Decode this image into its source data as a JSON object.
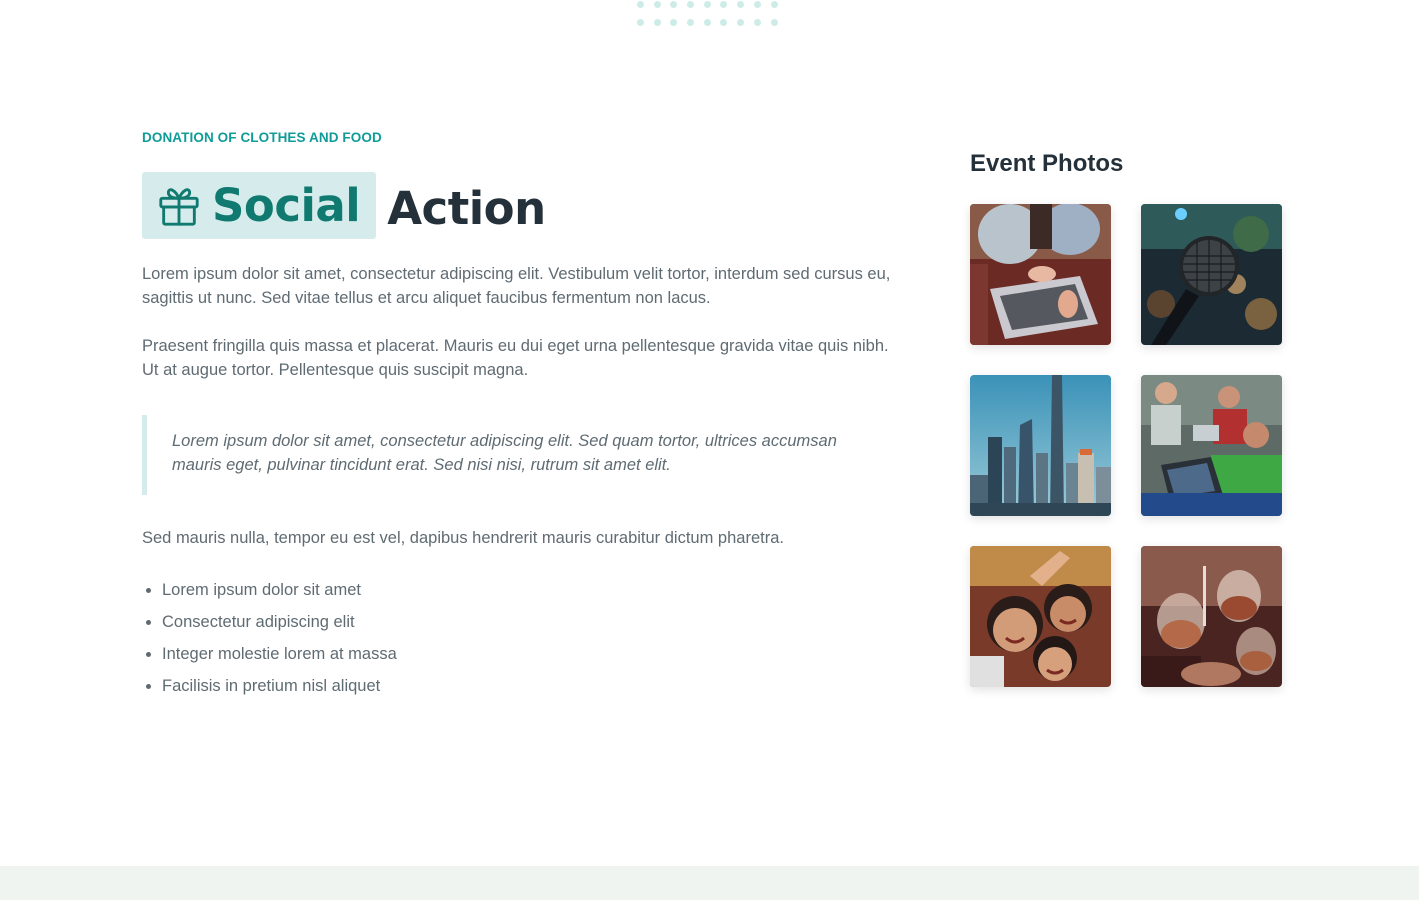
{
  "section": {
    "eyebrow": "DONATION OF CLOTHES AND FOOD",
    "title_accent": "Social",
    "title_rest": "Action",
    "title_icon": "gift-icon",
    "paragraph_1": "Lorem ipsum dolor sit amet, consectetur adipiscing elit. Vestibulum velit tortor, interdum sed cursus eu, sagittis ut nunc. Sed vitae tellus et arcu aliquet faucibus fermentum non lacus.",
    "paragraph_2": "Praesent fringilla quis massa et placerat. Mauris eu dui eget urna pellentesque gravida vitae quis nibh. Ut at augue tortor. Pellentesque quis suscipit magna.",
    "quote": "Lorem ipsum dolor sit amet, consectetur adipiscing elit. Sed quam tortor, ultrices accumsan mauris eget, pulvinar tincidunt erat. Sed nisi nisi, rutrum sit amet elit.",
    "paragraph_3": "Sed mauris nulla, tempor eu est vel, dapibus hendrerit mauris curabitur dictum pharetra.",
    "bullets": [
      "Lorem ipsum dolor sit amet",
      "Consectetur adipiscing elit",
      "Integer molestie lorem at massa",
      "Facilisis in pretium nisl aliquet"
    ]
  },
  "sidebar": {
    "title": "Event Photos",
    "photos": [
      {
        "subject": "laptop-hands"
      },
      {
        "subject": "microphone"
      },
      {
        "subject": "city-skyline"
      },
      {
        "subject": "people-laptops"
      },
      {
        "subject": "children-smiling"
      },
      {
        "subject": "wine-glasses"
      }
    ]
  },
  "colors": {
    "accent": "#0f9c98",
    "accent_dark": "#117a70",
    "badge_bg": "#d6ecec",
    "heading": "#24313a",
    "body_text": "#5f6b72",
    "footer_band": "#f0f4f0"
  }
}
